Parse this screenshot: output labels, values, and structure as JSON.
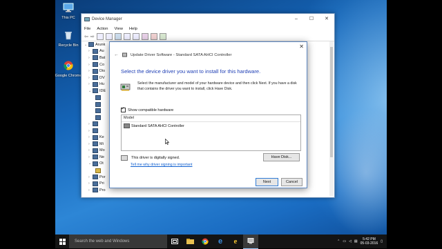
{
  "desktop": {
    "icons": [
      {
        "label": "This PC"
      },
      {
        "label": "Recycle Bin"
      },
      {
        "label": "Google Chrome"
      }
    ]
  },
  "device_manager": {
    "title": "Device Manager",
    "menu": [
      "File",
      "Action",
      "View",
      "Help"
    ],
    "tree_items": [
      "Arunk",
      "Au",
      "Bat",
      "Co",
      "Dis",
      "DV",
      "Hu",
      "IDE",
      "",
      "",
      "",
      "",
      "",
      "Ke",
      "Mi",
      "Mo",
      "Ne",
      "Ot",
      "",
      "Por",
      "Pri",
      "Pro"
    ]
  },
  "dialog": {
    "window_title": "Update Driver Software - Standard SATA AHCI Controller",
    "heading": "Select the device driver you want to install for this hardware.",
    "description": "Select the manufacturer and model of your hardware device and then click Next. If you have a disk that contains the driver you want to install, click Have Disk.",
    "show_compatible_label": "Show compatible hardware",
    "model_header": "Model",
    "model_items": [
      "Standard SATA AHCI Controller"
    ],
    "signed_text": "This driver is digitally signed.",
    "signing_link": "Tell me why driver signing is important",
    "have_disk_button": "Have Disk...",
    "next_button": "Next",
    "cancel_button": "Cancel"
  },
  "taskbar": {
    "search_placeholder": "Search the web and Windows",
    "time": "5:42 PM",
    "date": "05-03-2016"
  },
  "colors": {
    "heading_blue": "#1f3fb5",
    "link_blue": "#1060d0",
    "taskbar": "#141414"
  }
}
